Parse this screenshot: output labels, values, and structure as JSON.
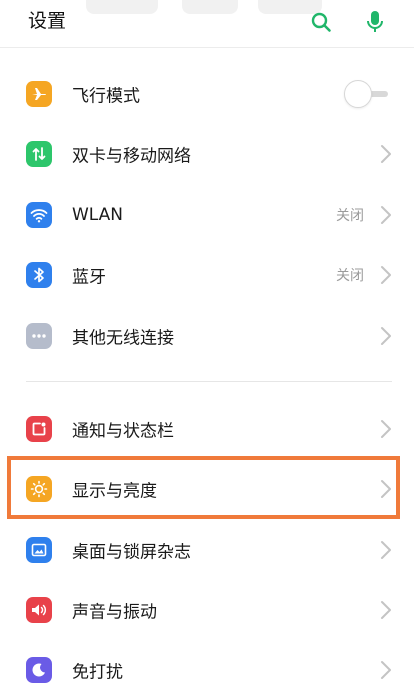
{
  "header": {
    "title": "设置",
    "icons": [
      "search-icon",
      "microphone-icon"
    ],
    "accent": "#20b66a"
  },
  "groups": [
    {
      "items": [
        {
          "label": "飞行模式",
          "icon": "airplane-icon",
          "icon_color": "#f5a623",
          "control": "toggle",
          "toggle_on": false
        },
        {
          "label": "双卡与移动网络",
          "icon": "dual-sim-data-icon",
          "icon_color": "#2dc66b",
          "control": "chevron"
        },
        {
          "label": "WLAN",
          "icon": "wifi-icon",
          "icon_color": "#2f80ed",
          "status": "关闭",
          "control": "chevron"
        },
        {
          "label": "蓝牙",
          "icon": "bluetooth-icon",
          "icon_color": "#2f80ed",
          "status": "关闭",
          "control": "chevron"
        },
        {
          "label": "其他无线连接",
          "icon": "more-dots-icon",
          "icon_color": "#b5bccb",
          "control": "chevron"
        }
      ]
    },
    {
      "items": [
        {
          "label": "通知与状态栏",
          "icon": "notification-icon",
          "icon_color": "#e8424a",
          "control": "chevron"
        },
        {
          "label": "显示与亮度",
          "icon": "brightness-icon",
          "icon_color": "#f5a623",
          "control": "chevron",
          "highlighted": true
        },
        {
          "label": "桌面与锁屏杂志",
          "icon": "wallpaper-icon",
          "icon_color": "#2f80ed",
          "control": "chevron"
        },
        {
          "label": "声音与振动",
          "icon": "speaker-icon",
          "icon_color": "#e8424a",
          "control": "chevron"
        },
        {
          "label": "免打扰",
          "icon": "moon-icon",
          "icon_color": "#6a5be6",
          "control": "chevron"
        }
      ]
    }
  ],
  "highlight_color": "#f07a3a"
}
